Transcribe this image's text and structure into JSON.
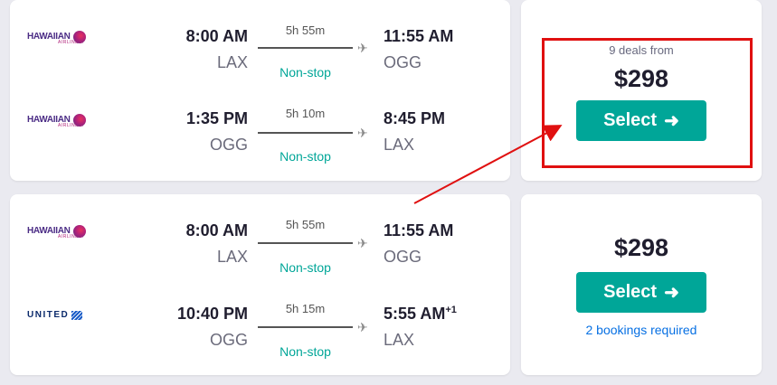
{
  "results": [
    {
      "legs": [
        {
          "airline": "HAWAIIAN",
          "airline_sub": "AIRLINES.",
          "logo": "hawaiian-logo",
          "dep_time": "8:00 AM",
          "dep_code": "LAX",
          "duration": "5h 55m",
          "stops": "Non-stop",
          "arr_time": "11:55 AM",
          "arr_suffix": "",
          "arr_code": "OGG"
        },
        {
          "airline": "HAWAIIAN",
          "airline_sub": "AIRLINES.",
          "logo": "hawaiian-logo",
          "dep_time": "1:35 PM",
          "dep_code": "OGG",
          "duration": "5h 10m",
          "stops": "Non-stop",
          "arr_time": "8:45 PM",
          "arr_suffix": "",
          "arr_code": "LAX"
        }
      ],
      "deals": "9 deals from",
      "price": "$298",
      "select_label": "Select",
      "bookings": ""
    },
    {
      "legs": [
        {
          "airline": "HAWAIIAN",
          "airline_sub": "AIRLINES.",
          "logo": "hawaiian-logo",
          "dep_time": "8:00 AM",
          "dep_code": "LAX",
          "duration": "5h 55m",
          "stops": "Non-stop",
          "arr_time": "11:55 AM",
          "arr_suffix": "",
          "arr_code": "OGG"
        },
        {
          "airline": "UNITED",
          "airline_sub": "",
          "logo": "united-logo",
          "dep_time": "10:40 PM",
          "dep_code": "OGG",
          "duration": "5h 15m",
          "stops": "Non-stop",
          "arr_time": "5:55 AM",
          "arr_suffix": "+1",
          "arr_code": "LAX"
        }
      ],
      "deals": "",
      "price": "$298",
      "select_label": "Select",
      "bookings": "2 bookings required"
    }
  ],
  "icons": {
    "plane": "airplane-icon",
    "arrow": "arrow-right-icon"
  },
  "colors": {
    "accent": "#00a698",
    "link": "#0770e3",
    "annotation": "#e01010",
    "text": "#1f1d2e"
  }
}
